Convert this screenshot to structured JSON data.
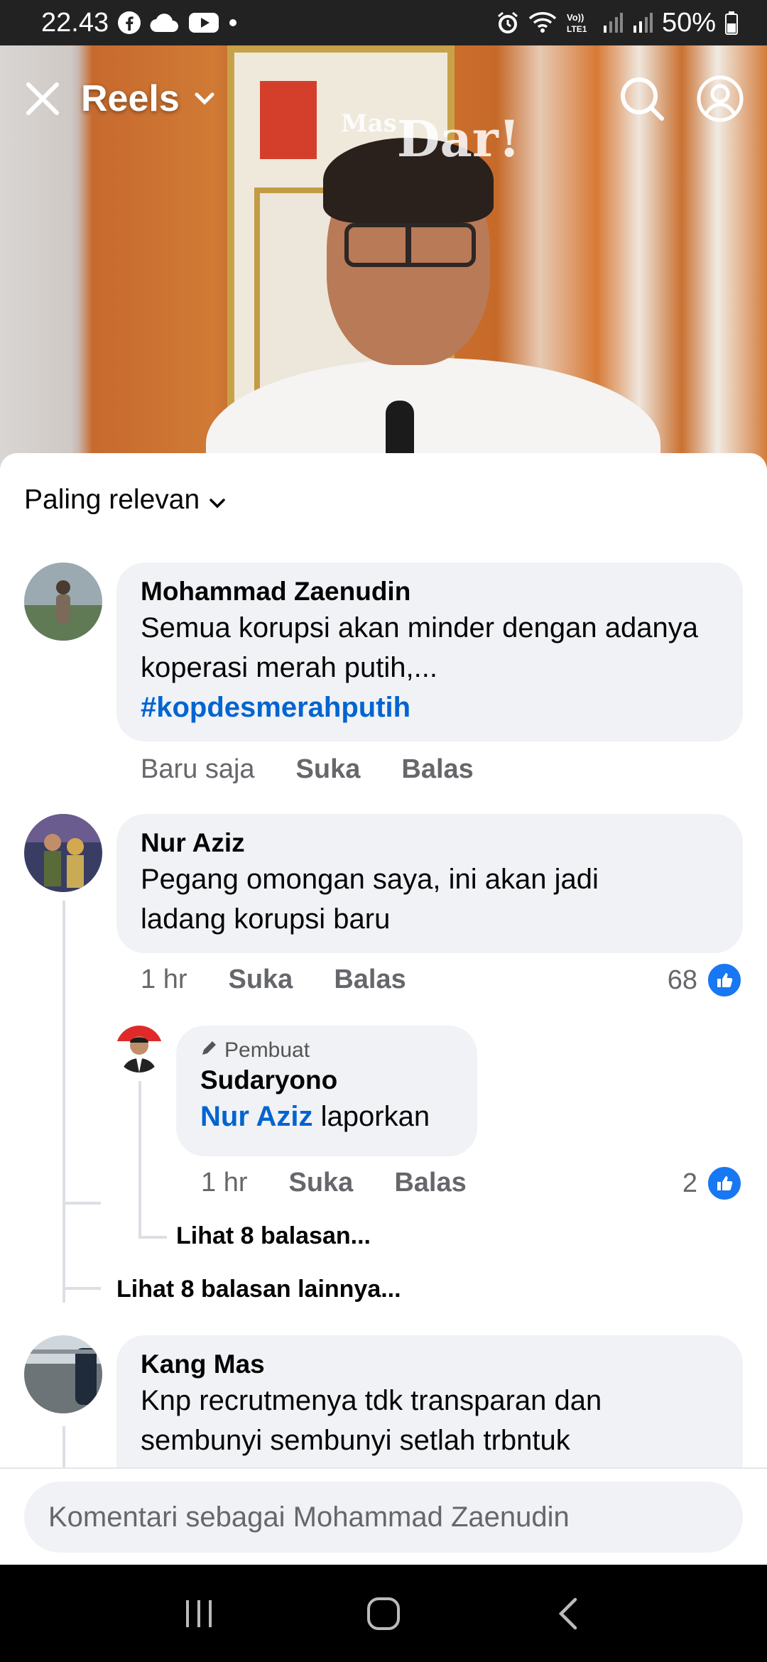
{
  "status_bar": {
    "time": "22.43",
    "battery": "50%",
    "left_icons": [
      "facebook-icon",
      "cloud-icon",
      "youtube-icon",
      "dot-icon"
    ],
    "right_icons": [
      "alarm-icon",
      "wifi-icon",
      "volte-icon",
      "signal-icon",
      "signal-icon",
      "battery-icon"
    ]
  },
  "header": {
    "title": "Reels",
    "watermark": "Dar!",
    "watermark_small": "Mas"
  },
  "comments_panel": {
    "sort_label": "Paling relevan",
    "comments": [
      {
        "author": "Mohammad Zaenudin",
        "text": "Semua korupsi akan minder dengan adanya koperasi merah putih,...",
        "hashtag": "#kopdesmerahputih",
        "time": "Baru saja",
        "like_label": "Suka",
        "reply_label": "Balas"
      },
      {
        "author": "Nur Aziz",
        "text": "Pegang omongan saya, ini akan jadi ladang korupsi baru",
        "time": "1 hr",
        "like_label": "Suka",
        "reply_label": "Balas",
        "reactions": "68",
        "reply": {
          "badge": "Pembuat",
          "author": "Sudaryono",
          "mention": "Nur Aziz",
          "text": " laporkan",
          "time": "1 hr",
          "like_label": "Suka",
          "reply_label": "Balas",
          "reactions": "2",
          "more_replies": "Lihat 8 balasan..."
        },
        "more_replies": "Lihat 8 balasan lainnya..."
      },
      {
        "author": "Kang Mas",
        "text": "Knp recrutmenya tdk transparan dan sembunyi sembunyi setlah trbntuk"
      }
    ],
    "composer_placeholder": "Komentari sebagai Mohammad Zaenudin"
  },
  "colors": {
    "accent": "#1877f2",
    "link": "#0064d1",
    "bubble": "#f0f2f5",
    "muted_text": "#65676b"
  }
}
